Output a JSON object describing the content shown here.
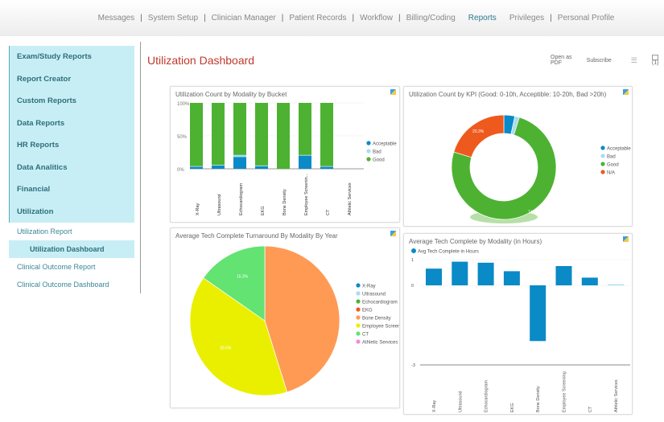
{
  "nav": {
    "items": [
      "Messages",
      "System Setup",
      "Clinician Manager",
      "Patient Records",
      "Workflow",
      "Billing/Coding",
      "Reports",
      "Privileges",
      "Personal Profile"
    ],
    "active": "Reports"
  },
  "sidebar": {
    "main": [
      "Exam/Study Reports",
      "Report Creator",
      "Custom Reports",
      "Data Reports",
      "HR Reports",
      "Data Analitics",
      "Financial",
      "Utilization"
    ],
    "sub": [
      "Utilization Report",
      "Utilization Dashboard",
      "Clinical Outcome Report",
      "Clinical Outcome Dashboard"
    ],
    "active_sub": "Utilization Dashboard"
  },
  "page": {
    "title": "Utilization Dashboard",
    "open_pdf": "Open as PDF",
    "subscribe": "Subscribe",
    "comments": "(1)",
    "stack_icon": "layers-icon",
    "comment_icon": "comment-icon"
  },
  "colors": {
    "acceptable": "#0a8ac6",
    "bad": "#a8dcf0",
    "good": "#4db232",
    "na": "#ee5a1e",
    "title": "#c0392b"
  },
  "chart_data": [
    {
      "type": "bar",
      "stacked": true,
      "title": "Utilization Count by Modality by Bucket",
      "categories": [
        "X-Ray",
        "Ultrasound",
        "Echocardiogram",
        "EKG",
        "Bone Density",
        "Employee Screenin...",
        "CT",
        "Athletic Services"
      ],
      "yticks": [
        "100%",
        "50%",
        "0%"
      ],
      "ylim": [
        0,
        100
      ],
      "series": [
        {
          "name": "Acceptable",
          "color": "#0a8ac6",
          "values": [
            3,
            5,
            18,
            4,
            0,
            20,
            3,
            0
          ]
        },
        {
          "name": "Bad",
          "color": "#a8dcf0",
          "values": [
            1,
            1,
            3,
            1,
            0,
            1,
            1,
            0
          ]
        },
        {
          "name": "Good",
          "color": "#4db232",
          "values": [
            96,
            94,
            79,
            95,
            100,
            79,
            96,
            0
          ]
        }
      ],
      "legend": "right"
    },
    {
      "type": "pie",
      "donut": true,
      "title": "Utilization Count by KPI (Good: 0-10h, Acceptible: 10-20h, Bad >20h)",
      "labels": [
        "Acceptable",
        "Bad",
        "Good",
        "N/A"
      ],
      "values": [
        3.4,
        1.4,
        74.9,
        20.3
      ],
      "colors": [
        "#0a8ac6",
        "#a8dcf0",
        "#4db232",
        "#ee5a1e"
      ],
      "data_labels": [
        "",
        "",
        "74.9%",
        "20.3%"
      ],
      "legend": "right"
    },
    {
      "type": "pie",
      "title": "Average Tech Complete Turnaround By Modality By Year",
      "labels": [
        "X-Ray",
        "Ultrasound",
        "Echocardiogram",
        "EKG",
        "Bone Density",
        "Employee Screer",
        "CT",
        "Athletic Services"
      ],
      "values": [
        0,
        0,
        0,
        0,
        45.2,
        39.5,
        15.3,
        0
      ],
      "colors": [
        "#0a8ac6",
        "#a8dcf0",
        "#4db232",
        "#ee5a1e",
        "#ff9a55",
        "#eaef00",
        "#62e372",
        "#f58ad8"
      ],
      "data_labels": [
        "",
        "",
        "",
        "",
        "",
        "39.5%",
        "15.3%",
        ""
      ],
      "legend": "right"
    },
    {
      "type": "bar",
      "title": "Average Tech Complete by Modality (in Hours)",
      "categories": [
        "X-Ray",
        "Ultrasound",
        "Echocardiogram",
        "EKG",
        "Bone Density",
        "Employee Screening",
        "CT",
        "Athletic Services"
      ],
      "series": [
        {
          "name": "Avg Tech Complete in Hours",
          "color": "#0a8ac6",
          "values": [
            0.65,
            0.92,
            0.88,
            0.55,
            -2.1,
            0.75,
            0.3,
            0.04
          ]
        }
      ],
      "yticks": [
        1,
        0,
        -3
      ],
      "ylim": [
        -3,
        1
      ],
      "legend": "top-left"
    }
  ]
}
